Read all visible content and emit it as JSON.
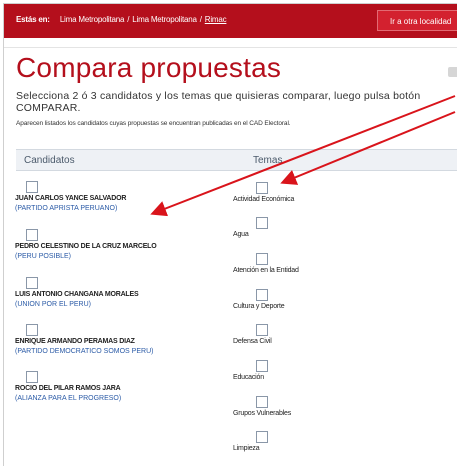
{
  "breadcrumb": {
    "label": "Estás en:",
    "items": [
      "Lima Metropolitana",
      "Lima Metropolitana",
      "Rimac"
    ]
  },
  "header": {
    "go_other": "Ir a otra localidad"
  },
  "page": {
    "title": "Compara propuestas",
    "instructions": "Selecciona 2 ó 3 candidatos y los temas que quisieras comparar, luego pulsa botón COMPARAR.",
    "note": "Aparecen listados los candidatos cuyas propuestas se encuentran publicadas en el CAD Electoral."
  },
  "columns": {
    "candidatos": "Candidatos",
    "temas": "Temas"
  },
  "candidates": [
    {
      "name": "JUAN CARLOS YANCE SALVADOR",
      "party": "(PARTIDO APRISTA PERUANO)"
    },
    {
      "name": "PEDRO CELESTINO DE LA CRUZ MARCELO",
      "party": "(PERU POSIBLE)"
    },
    {
      "name": "LUIS ANTONIO CHANGANA MORALES",
      "party": "(UNION POR EL PERU)"
    },
    {
      "name": "ENRIQUE ARMANDO PERAMAS DIAZ",
      "party": "(PARTIDO DEMOCRATICO SOMOS PERU)"
    },
    {
      "name": "ROCIO DEL PILAR RAMOS JARA",
      "party": "(ALIANZA PARA EL PROGRESO)"
    }
  ],
  "topics": [
    "Actividad Económica",
    "Agua",
    "Atención en la Entidad",
    "Cultura y Deporte",
    "Defensa Civil",
    "Educación",
    "Grupos Vulnerables",
    "Limpieza"
  ],
  "colors": {
    "brand_red": "#b40f1c",
    "party_blue": "#2a5aa6",
    "annotation_red": "#d9141b"
  }
}
